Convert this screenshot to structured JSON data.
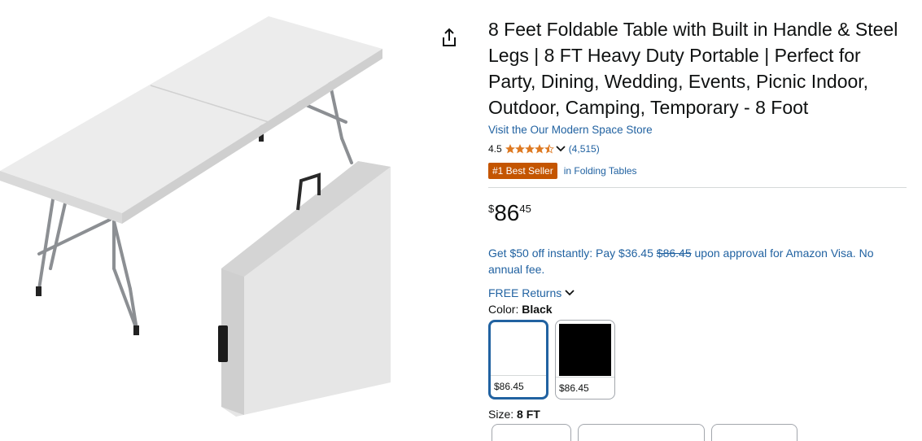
{
  "product": {
    "title": "8 Feet Foldable Table with Built in Handle & Steel Legs | 8 FT Heavy Duty Portable | Perfect for Party, Dining, Wedding, Events, Picnic Indoor, Outdoor, Camping, Temporary - 8 Foot",
    "store_link": "Visit the Our Modern Space Store",
    "rating": "4.5",
    "rating_value": 4.5,
    "rating_count": "(4,515)",
    "badge": "#1 Best Seller",
    "badge_category": "in Folding Tables",
    "price": {
      "symbol": "$",
      "whole": "86",
      "fraction": "45"
    },
    "offer": {
      "before": "Get $50 off instantly: Pay $36.45 ",
      "strike": "$86.45",
      "after": " upon approval for Amazon Visa. No annual fee."
    },
    "returns": "FREE Returns",
    "color_label": "Color: ",
    "color_value": "Black",
    "color_options": [
      {
        "price": "$86.45",
        "swatch": "#ffffff",
        "selected": true
      },
      {
        "price": "$86.45",
        "swatch": "#000000",
        "selected": false
      }
    ],
    "size_label": "Size: ",
    "size_value": "8 FT"
  },
  "colors": {
    "link": "#2162a1",
    "badge": "#c45500",
    "star": "#de7921",
    "text": "#0f1111"
  },
  "icons": {
    "share": "share-icon",
    "star": "star-icon",
    "chevron": "chevron-down-icon"
  }
}
